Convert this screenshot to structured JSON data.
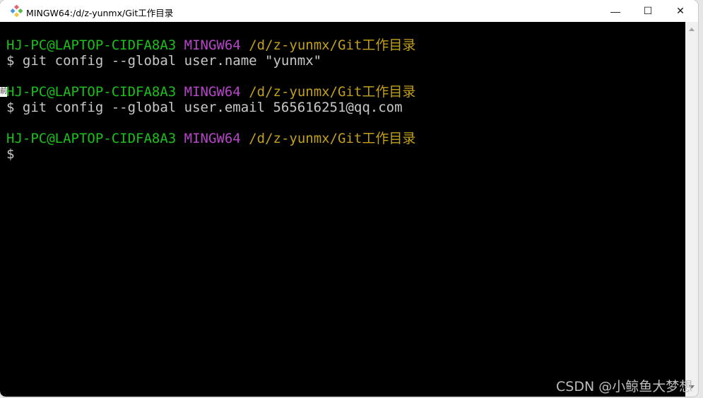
{
  "window": {
    "title": "MINGW64:/d/z-yunmx/Git工作目录",
    "app_icon": "git-diamond-icon",
    "controls": {
      "minimize": "—",
      "maximize": "☐",
      "close": "✕"
    }
  },
  "terminal": {
    "blocks": [
      {
        "prompt": {
          "user_host": "HJ-PC@LAPTOP-CIDFA8A3",
          "system": "MINGW64",
          "path": "/d/z-yunmx/Git工作目录"
        },
        "command": "$ git config --global user.name \"yunmx\""
      },
      {
        "prompt": {
          "user_host": "HJ-PC@LAPTOP-CIDFA8A3",
          "system": "MINGW64",
          "path": "/d/z-yunmx/Git工作目录"
        },
        "command": "$ git config --global user.email 565616251@qq.com"
      },
      {
        "prompt": {
          "user_host": "HJ-PC@LAPTOP-CIDFA8A3",
          "system": "MINGW64",
          "path": "/d/z-yunmx/Git工作目录"
        },
        "command": "$"
      }
    ],
    "colors": {
      "user_host": "#19c119",
      "system": "#b645c8",
      "path": "#c1a01a",
      "text": "#c8c8c8",
      "background": "#000000"
    }
  },
  "overlay": {
    "edge_artifact": "前",
    "watermark": "CSDN @小鲸鱼大梦想"
  }
}
